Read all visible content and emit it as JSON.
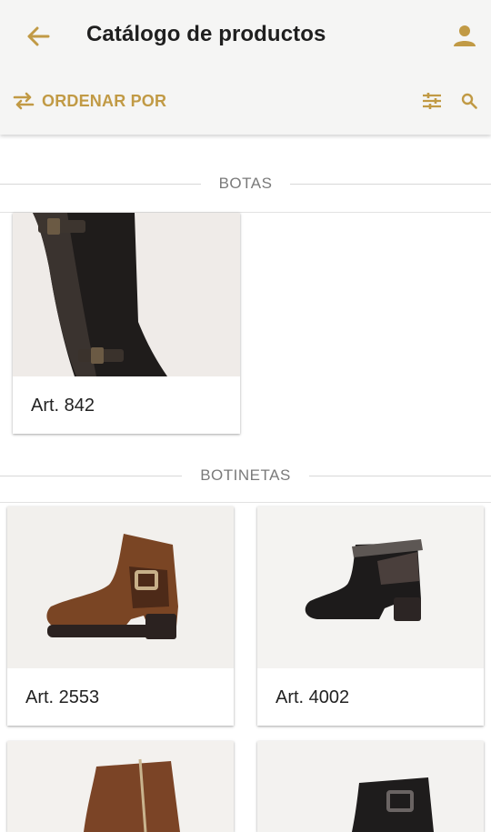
{
  "appbar": {
    "title": "Catálogo de productos",
    "back_icon": "arrow-back-icon",
    "user_icon": "account-icon"
  },
  "toolbar": {
    "sort_label": "ORDENAR POR",
    "sort_icon": "swap-arrows-icon",
    "filter_icon": "tune-icon",
    "search_icon": "search-icon"
  },
  "colors": {
    "accent": "#c19a45",
    "appbar_bg": "#f5f5f4",
    "title_text": "#1f1f1f",
    "section_text": "#7a7a7a"
  },
  "sections": [
    {
      "label": "BOTAS",
      "products": [
        {
          "label": "Art. 842",
          "image": "tall-black-boot-photo"
        }
      ]
    },
    {
      "label": "BOTINETAS",
      "products": [
        {
          "label": "Art. 2553",
          "image": "brown-buckle-ankle-boot-photo"
        },
        {
          "label": "Art. 4002",
          "image": "black-studded-ankle-boot-photo"
        },
        {
          "label": "",
          "image": "brown-zip-ankle-boot-photo"
        },
        {
          "label": "",
          "image": "black-buckle-ankle-boot-photo"
        }
      ]
    }
  ]
}
